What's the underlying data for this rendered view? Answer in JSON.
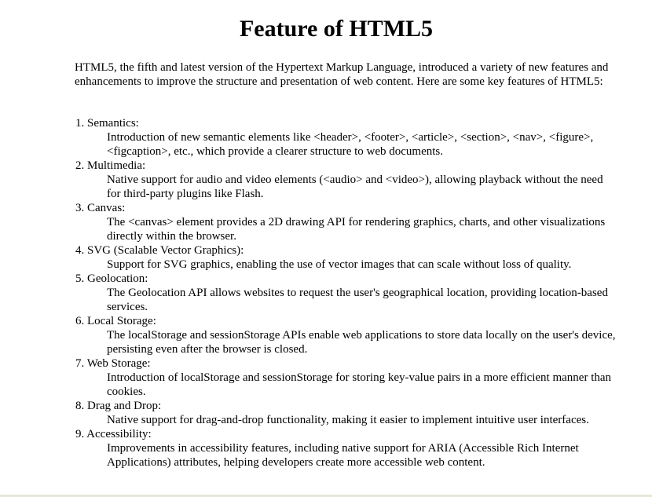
{
  "title": "Feature of HTML5",
  "intro": "HTML5, the fifth and latest version of the Hypertext Markup Language, introduced a variety of new features and enhancements to improve the structure and presentation of web content. Here are some key features of HTML5:",
  "features": [
    {
      "term": "1. Semantics:",
      "desc": "Introduction of new semantic elements like <header>, <footer>, <article>, <section>, <nav>, <figure>, <figcaption>, etc., which provide a clearer structure to web documents."
    },
    {
      "term": "2. Multimedia:",
      "desc": "Native support for audio and video elements (<audio> and <video>), allowing playback without the need for third-party plugins like Flash."
    },
    {
      "term": "3. Canvas:",
      "desc": "The <canvas> element provides a 2D drawing API for rendering graphics, charts, and other visualizations directly within the browser."
    },
    {
      "term": "4. SVG (Scalable Vector Graphics):",
      "desc": "Support for SVG graphics, enabling the use of vector images that can scale without loss of quality."
    },
    {
      "term": "5. Geolocation:",
      "desc": "The Geolocation API allows websites to request the user's geographical location, providing location-based services."
    },
    {
      "term": "6. Local Storage:",
      "desc": "The localStorage and sessionStorage APIs enable web applications to store data locally on the user's device, persisting even after the browser is closed."
    },
    {
      "term": "7. Web Storage:",
      "desc": "Introduction of localStorage and sessionStorage for storing key-value pairs in a more efficient manner than cookies."
    },
    {
      "term": "8. Drag and Drop:",
      "desc": "Native support for drag-and-drop functionality, making it easier to implement intuitive user interfaces."
    },
    {
      "term": "9. Accessibility:",
      "desc": "Improvements in accessibility features, including native support for ARIA (Accessible Rich Internet Applications) attributes, helping developers create more accessible web content."
    }
  ]
}
